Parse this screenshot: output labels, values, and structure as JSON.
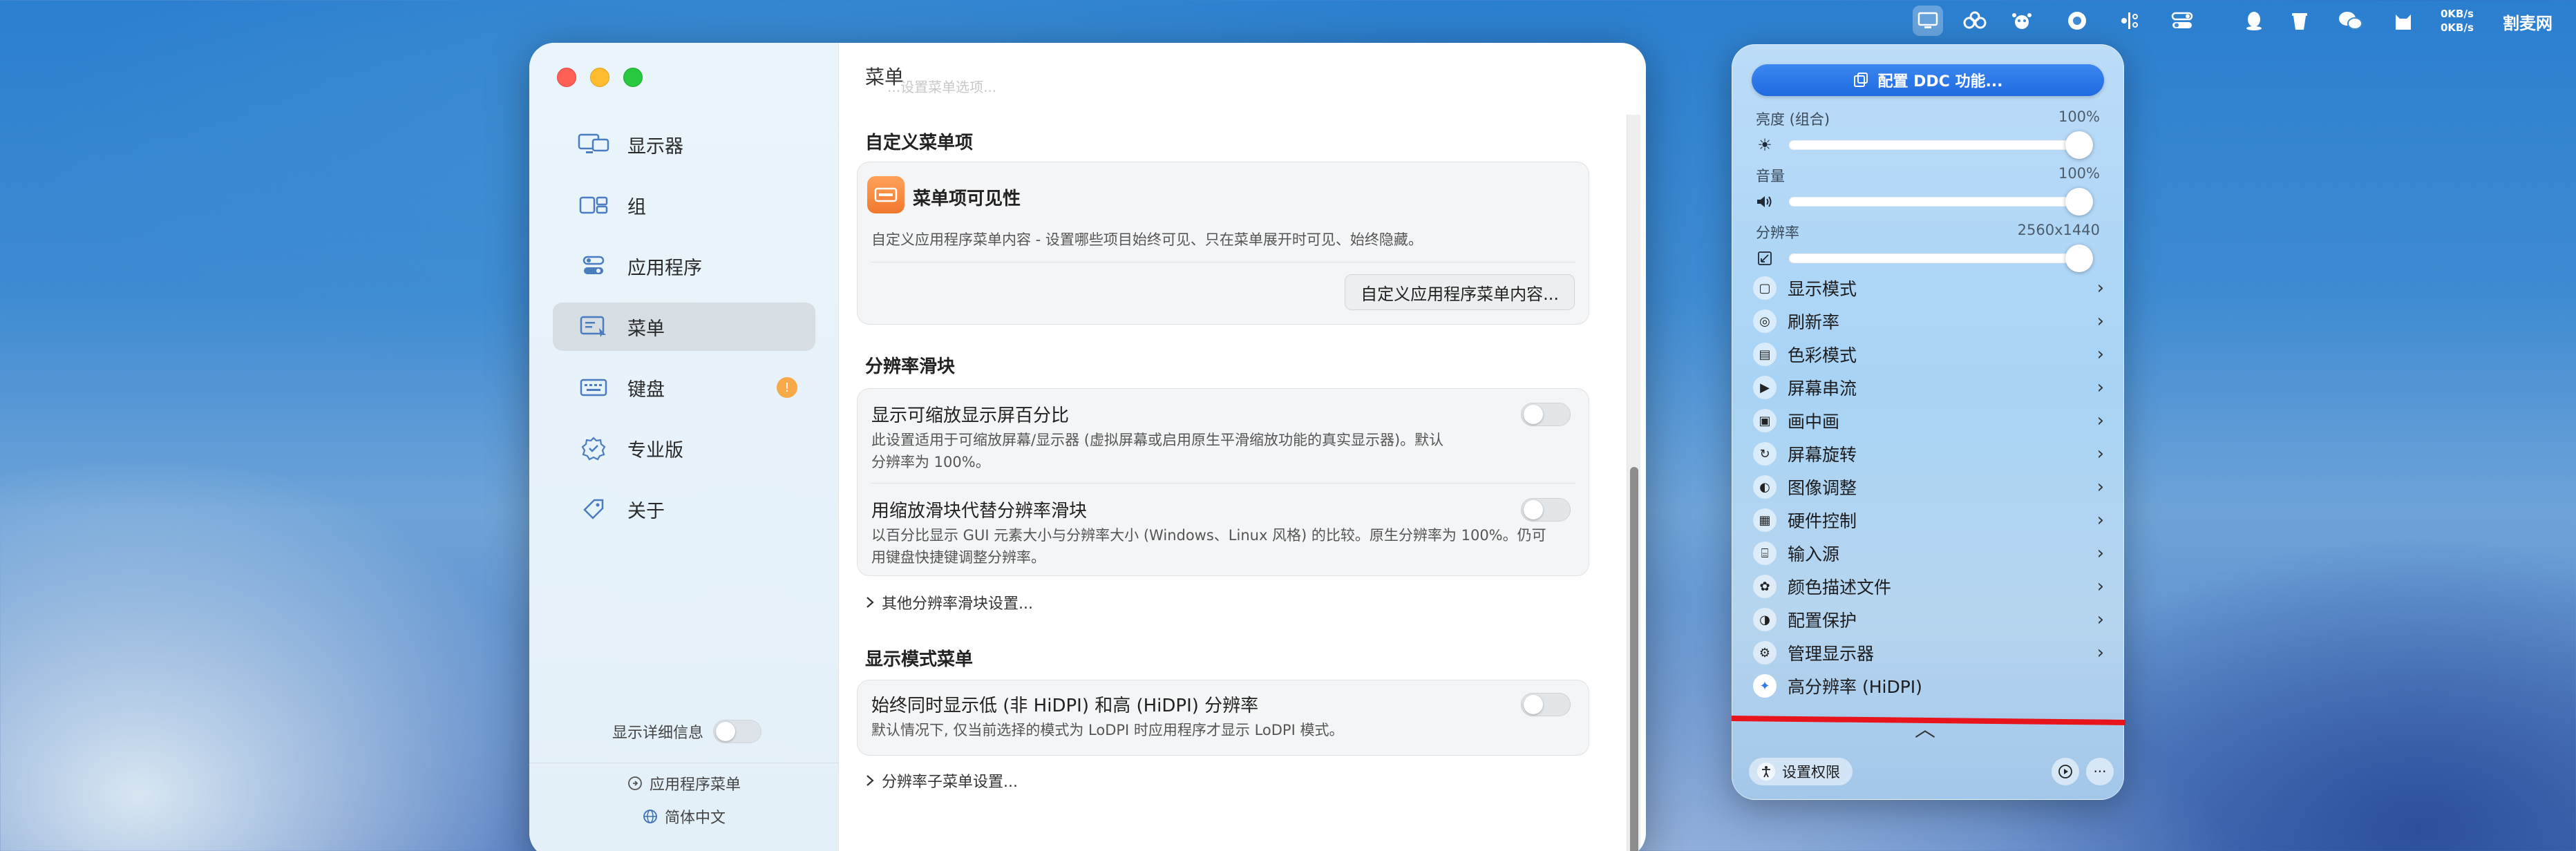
{
  "menubar": {
    "net_up": "0KB/s",
    "net_down": "0KB/s",
    "brand": "割麦网"
  },
  "sidebar": {
    "items": [
      {
        "label": "显示器",
        "icon": "displays-icon"
      },
      {
        "label": "组",
        "icon": "group-icon"
      },
      {
        "label": "应用程序",
        "icon": "app-icon"
      },
      {
        "label": "菜单",
        "icon": "menu-icon"
      },
      {
        "label": "键盘",
        "icon": "keyboard-icon"
      },
      {
        "label": "专业版",
        "icon": "pro-badge-icon"
      },
      {
        "label": "关于",
        "icon": "tag-icon"
      }
    ],
    "detail_label": "显示详细信息",
    "app_menu_link": "应用程序菜单",
    "language_link": "简体中文"
  },
  "content": {
    "title": "菜单",
    "ghost": "...设置菜单选项...",
    "section1": {
      "heading": "自定义菜单项",
      "card_title": "菜单项可见性",
      "card_desc": "自定义应用程序菜单内容 - 设置哪些项目始终可见、只在菜单展开时可见、始终隐藏。",
      "button": "自定义应用程序菜单内容..."
    },
    "section2": {
      "heading": "分辨率滑块",
      "row1_title": "显示可缩放显示屏百分比",
      "row1_desc_1": "此设置适用于可缩放屏幕/显示器 (虚拟屏幕或启用原生平滑缩放功能的真实显示器)。默认",
      "row1_desc_2": "分辨率为 100%。",
      "row2_title": "用缩放滑块代替分辨率滑块",
      "row2_desc_1": "以百分比显示 GUI 元素大小与分辨率大小 (Windows、Linux 风格) 的比较。原生分辨率为 100%。仍可",
      "row2_desc_2": "用键盘快捷键调整分辨率。",
      "disclosure": "其他分辨率滑块设置..."
    },
    "section3": {
      "heading": "显示模式菜单",
      "row_title": "始终同时显示低 (非 HiDPI) 和高 (HiDPI) 分辨率",
      "row_desc": "默认情况下, 仅当前选择的模式为 LoDPI 时应用程序才显示 LoDPI 模式。",
      "disclosure": "分辨率子菜单设置..."
    }
  },
  "panel": {
    "ddc_button": "配置 DDC 功能...",
    "brightness_label": "亮度 (组合)",
    "brightness_value": "100%",
    "brightness_level": 1.0,
    "volume_label": "音量",
    "volume_value": "100%",
    "volume_level": 1.0,
    "resolution_label": "分辨率",
    "resolution_value": "2560x1440",
    "resolution_level": 1.0,
    "items": [
      {
        "label": "显示模式",
        "icon": "display-mode-icon",
        "glyph": "▢"
      },
      {
        "label": "刷新率",
        "icon": "refresh-rate-icon",
        "glyph": "◎"
      },
      {
        "label": "色彩模式",
        "icon": "color-mode-icon",
        "glyph": "▤"
      },
      {
        "label": "屏幕串流",
        "icon": "screen-stream-icon",
        "glyph": "▶"
      },
      {
        "label": "画中画",
        "icon": "pip-icon",
        "glyph": "▣"
      },
      {
        "label": "屏幕旋转",
        "icon": "rotate-icon",
        "glyph": "↻"
      },
      {
        "label": "图像调整",
        "icon": "image-adjust-icon",
        "glyph": "◐"
      },
      {
        "label": "硬件控制",
        "icon": "hardware-icon",
        "glyph": "▦"
      },
      {
        "label": "输入源",
        "icon": "input-source-icon",
        "glyph": "⌸"
      },
      {
        "label": "颜色描述文件",
        "icon": "color-profile-icon",
        "glyph": "✿"
      },
      {
        "label": "配置保护",
        "icon": "protect-icon",
        "glyph": "◑"
      },
      {
        "label": "管理显示器",
        "icon": "manage-displays-icon",
        "glyph": "⚙"
      }
    ],
    "hidpi_label": "高分辨率 (HiDPI)",
    "permissions_button": "设置权限",
    "chevron": "›",
    "collapse": "︿",
    "more": "···"
  },
  "colors": {
    "accent": "#1f6ae0",
    "annotation_red": "#e8141c"
  }
}
